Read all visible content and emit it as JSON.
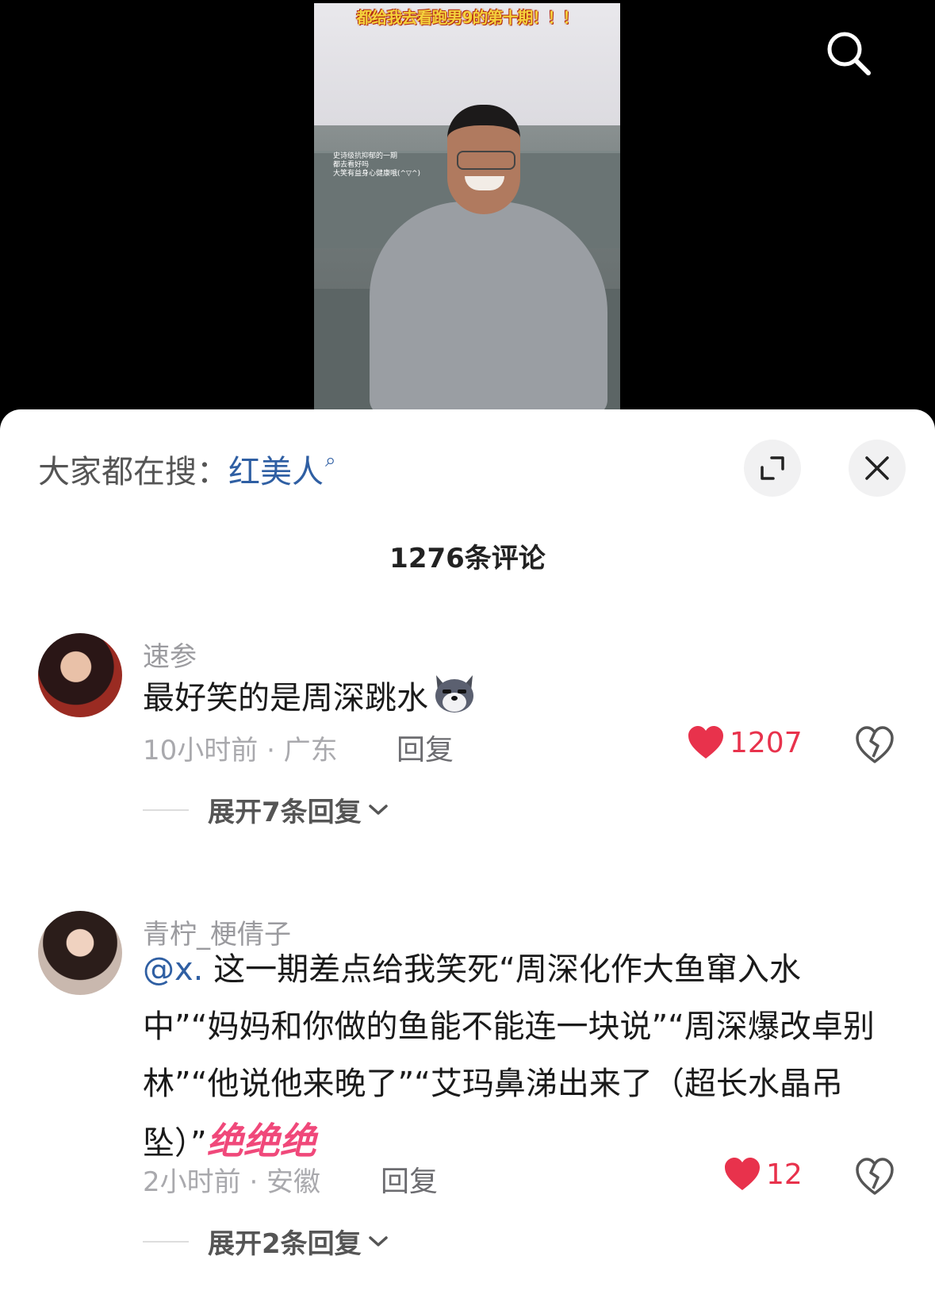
{
  "video": {
    "caption": "都给我去看跑男9的第十期！！！",
    "overlay_text": "史诗级抗抑郁的一期\n都去看好吗\n大笑有益身心健康哦(^▽^)"
  },
  "sheet": {
    "trending_prefix": "大家都在搜：",
    "trending_term": "红美人",
    "comment_count_title": "1276条评论"
  },
  "comments": [
    {
      "username": "速参",
      "text": "最好笑的是周深跳水",
      "emoji": "wolf-emoji",
      "meta": "10小时前 · 广东",
      "reply_label": "回复",
      "likes": "1207",
      "expand_label": "展开7条回复"
    },
    {
      "username": "青柠_梗倩子",
      "mention": "@x.",
      "text": " 这一期差点给我笑死“周深化作大鱼窜入水中”“妈妈和你做的鱼能不能连一块说”“周深爆改卓别林”“他说他来晚了”“艾玛鼻涕出来了（超长水晶吊坠）”",
      "emphasis": "绝绝绝",
      "meta": "2小时前 · 安徽",
      "reply_label": "回复",
      "likes": "12",
      "expand_label": "展开2条回复"
    }
  ],
  "colors": {
    "accent_blue": "#2f5fa3",
    "like_red": "#e8324c",
    "emphasis_pink": "#f0487a"
  }
}
